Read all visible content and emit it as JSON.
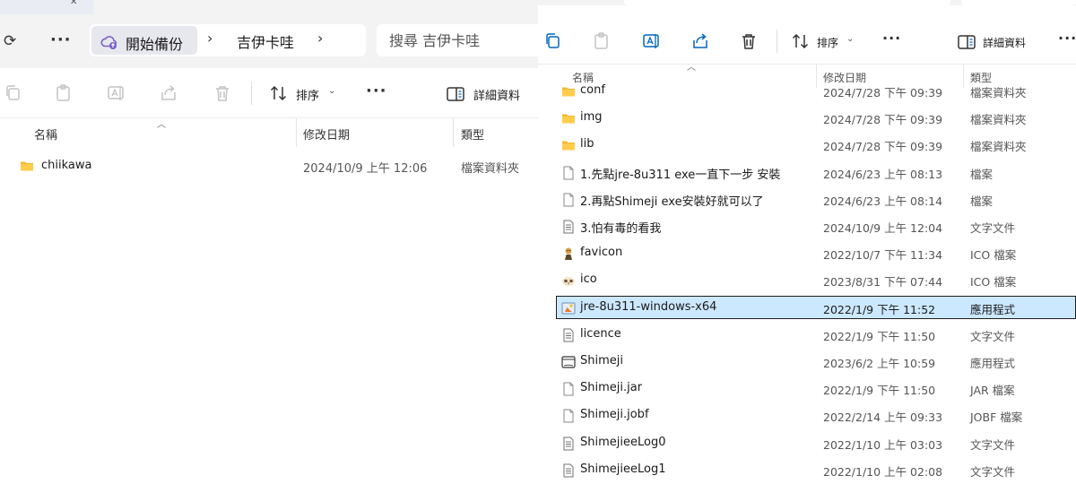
{
  "left": {
    "addressbar": {
      "home_label": "開始備份",
      "crumb_folder": "吉伊卡哇",
      "search_placeholder": "搜尋 吉伊卡哇"
    },
    "toolbar": {
      "sort_label": "排序",
      "details_label": "詳細資料"
    },
    "columns": {
      "name": "名稱",
      "modified": "修改日期",
      "type": "類型"
    },
    "files": [
      {
        "name": "chiikawa",
        "modified": "2024/10/9 上午 12:06",
        "type": "檔案資料夾",
        "icon": "folder-icon"
      }
    ]
  },
  "right": {
    "toolbar": {
      "sort_label": "排序",
      "details_label": "詳細資料"
    },
    "columns": {
      "name": "名稱",
      "modified": "修改日期",
      "type": "類型"
    },
    "files": [
      {
        "name": "conf",
        "modified": "2024/7/28 下午 09:39",
        "type": "檔案資料夾",
        "icon": "folder-icon"
      },
      {
        "name": "img",
        "modified": "2024/7/28 下午 09:39",
        "type": "檔案資料夾",
        "icon": "folder-icon"
      },
      {
        "name": "lib",
        "modified": "2024/7/28 下午 09:39",
        "type": "檔案資料夾",
        "icon": "folder-icon"
      },
      {
        "name": "1.先點jre-8u311 exe一直下一步 安裝",
        "modified": "2024/6/23 上午 08:13",
        "type": "檔案",
        "icon": "blank-file-icon"
      },
      {
        "name": "2.再點Shimeji exe安裝好就可以了",
        "modified": "2024/6/23 上午 08:14",
        "type": "檔案",
        "icon": "blank-file-icon"
      },
      {
        "name": "3.怕有毒的看我",
        "modified": "2024/10/9 上午 12:04",
        "type": "文字文件",
        "icon": "text-file-icon"
      },
      {
        "name": "favicon",
        "modified": "2022/10/7 下午 11:34",
        "type": "ICO 檔案",
        "icon": "character-icon"
      },
      {
        "name": "ico",
        "modified": "2023/8/31 下午 07:44",
        "type": "ICO 檔案",
        "icon": "character-face-icon"
      },
      {
        "name": "jre-8u311-windows-x64",
        "modified": "2022/1/9 下午 11:52",
        "type": "應用程式",
        "icon": "installer-icon",
        "selected": true
      },
      {
        "name": "licence",
        "modified": "2022/1/9 下午 11:50",
        "type": "文字文件",
        "icon": "text-file-icon"
      },
      {
        "name": "Shimeji",
        "modified": "2023/6/2 上午 10:59",
        "type": "應用程式",
        "icon": "app-window-icon"
      },
      {
        "name": "Shimeji.jar",
        "modified": "2022/1/9 下午 11:50",
        "type": "JAR 檔案",
        "icon": "blank-file-icon"
      },
      {
        "name": "Shimeji.jobf",
        "modified": "2022/2/14 上午 09:33",
        "type": "JOBF 檔案",
        "icon": "blank-file-icon"
      },
      {
        "name": "ShimejieeLog0",
        "modified": "2022/1/10 上午 03:03",
        "type": "文字文件",
        "icon": "text-file-icon"
      },
      {
        "name": "ShimejieeLog1",
        "modified": "2022/1/10 上午 02:08",
        "type": "文字文件",
        "icon": "text-file-icon"
      }
    ]
  },
  "colors": {
    "selection_fill": "#cce8ff",
    "folder_yellow": "#f5b82e",
    "accent": "#7a62c9"
  }
}
